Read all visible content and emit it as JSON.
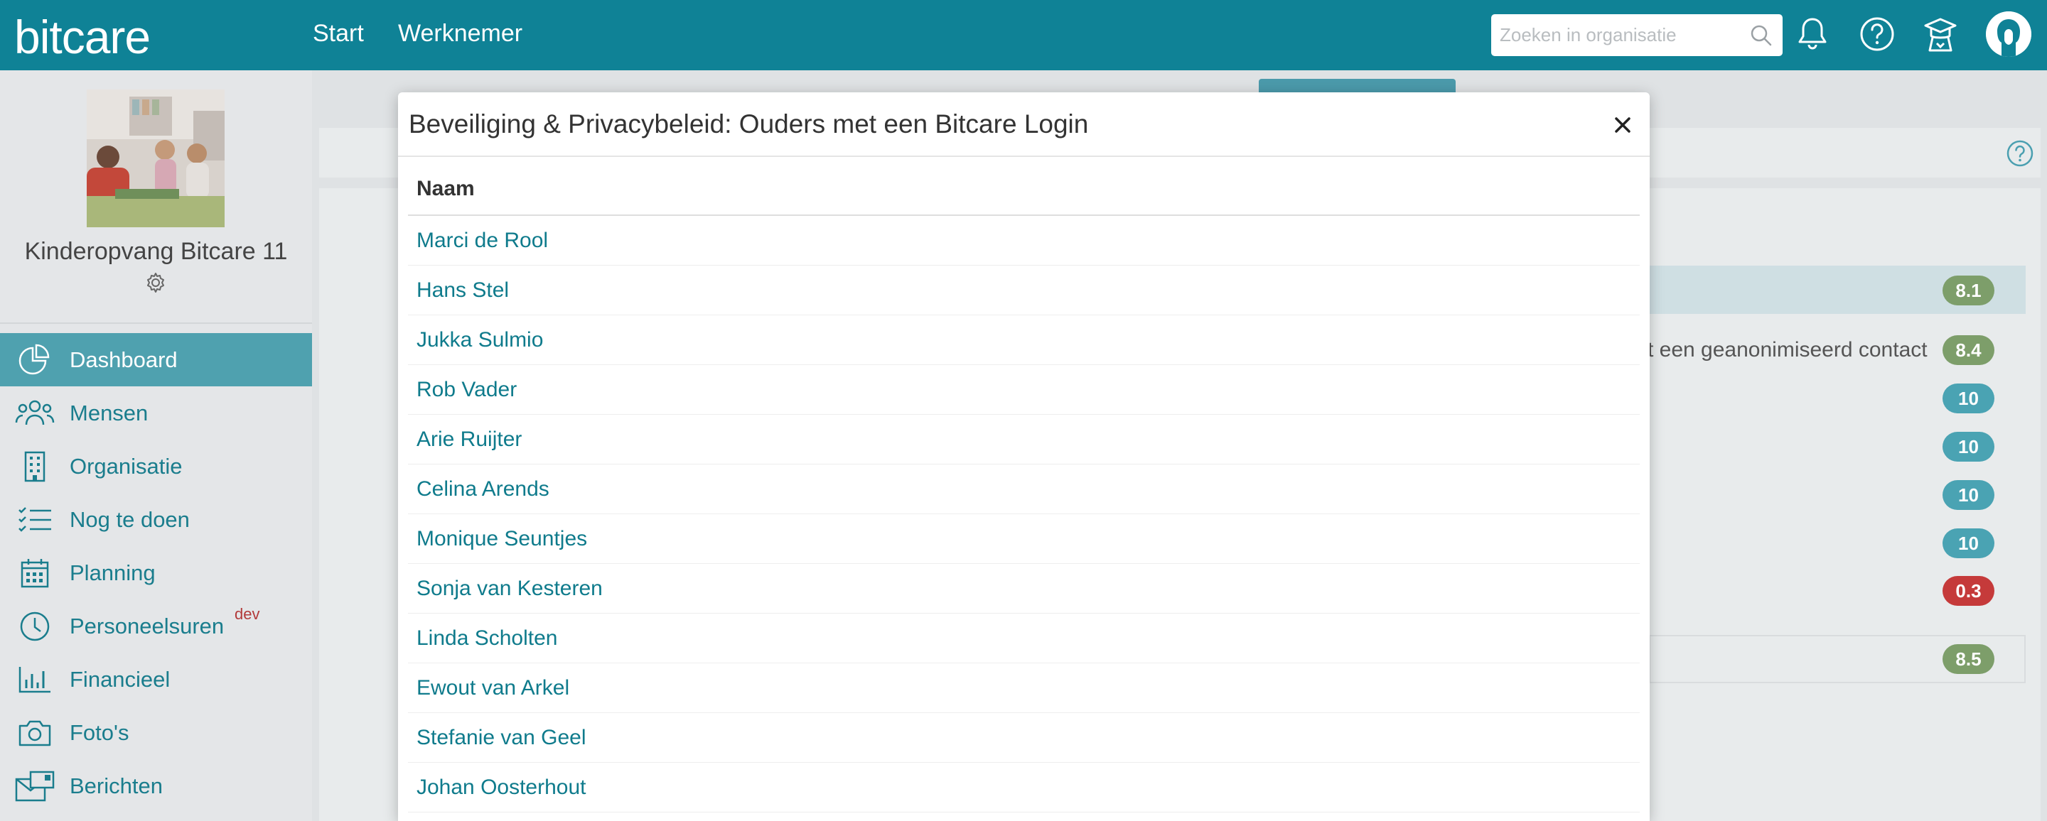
{
  "app": {
    "logo": "bitcare"
  },
  "topnav": {
    "start": "Start",
    "werknemer": "Werknemer"
  },
  "search": {
    "placeholder": "Zoeken in organisatie"
  },
  "sidebar": {
    "org_name": "Kinderopvang Bitcare 11",
    "items": [
      {
        "label": "Dashboard",
        "icon": "pie-chart-icon",
        "active": true
      },
      {
        "label": "Mensen",
        "icon": "people-icon"
      },
      {
        "label": "Organisatie",
        "icon": "building-icon"
      },
      {
        "label": "Nog te doen",
        "icon": "checklist-icon"
      },
      {
        "label": "Planning",
        "icon": "calendar-icon"
      },
      {
        "label": "Personeelsuren",
        "icon": "clock-icon",
        "badge": "dev"
      },
      {
        "label": "Financieel",
        "icon": "bar-chart-icon"
      },
      {
        "label": "Foto's",
        "icon": "camera-icon"
      },
      {
        "label": "Berichten",
        "icon": "messages-icon"
      }
    ]
  },
  "background": {
    "partial_text": "t een geanonimiseerd contact",
    "scores": [
      "8.1",
      "8.4",
      "10",
      "10",
      "10",
      "10",
      "0.3",
      "8.5"
    ]
  },
  "modal": {
    "title": "Beveiliging & Privacybeleid: Ouders met een Bitcare Login",
    "column_header": "Naam",
    "rows": [
      "Marci de Rool",
      "Hans Stel",
      "Jukka Sulmio",
      "Rob Vader",
      "Arie Ruijter",
      "Celina Arends",
      "Monique Seuntjes",
      "Sonja van Kesteren",
      "Linda Scholten",
      "Ewout van Arkel",
      "Stefanie van Geel",
      "Johan Oosterhout"
    ]
  },
  "colors": {
    "brand": "#0f8296",
    "link": "#0f7b8c",
    "active_menu": "#4fa1af"
  }
}
